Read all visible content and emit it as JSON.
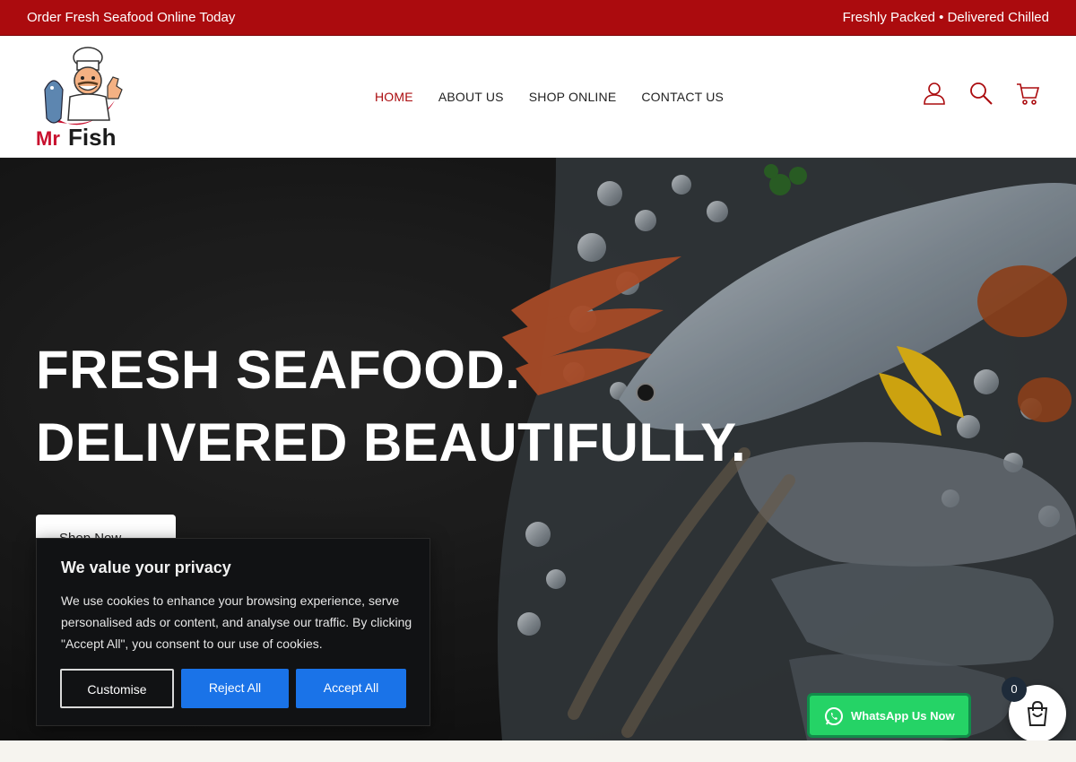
{
  "topbar": {
    "left_text": "Order Fresh Seafood Online Today",
    "right_text": "Freshly Packed • Delivered Chilled",
    "color": "#ab0b0e"
  },
  "brand": {
    "logo_text_1": "Mr",
    "logo_text_2": "Fish"
  },
  "nav": {
    "items": [
      {
        "label": "HOME",
        "active": true
      },
      {
        "label": "ABOUT US",
        "active": false
      },
      {
        "label": "SHOP ONLINE",
        "active": false
      },
      {
        "label": "CONTACT US",
        "active": false
      }
    ]
  },
  "header_icons": [
    "user-icon",
    "search-icon",
    "cart-icon"
  ],
  "hero": {
    "line1": "FRESH SEAFOOD.",
    "line2": "DELIVERED BEAUTIFULLY.",
    "cta_label": "Shop Now  →"
  },
  "cookie": {
    "title": "We value your privacy",
    "body": "We use cookies to enhance your browsing experience, serve personalised ads or content, and analyse our traffic. By clicking \"Accept All\", you consent to our use of cookies.",
    "customise_label": "Customise",
    "reject_label": "Reject All",
    "accept_label": "Accept All",
    "accent": "#1a73e8"
  },
  "whatsapp": {
    "label": "WhatsApp Us Now",
    "color": "#25d366"
  },
  "floating_cart": {
    "count": "0"
  }
}
